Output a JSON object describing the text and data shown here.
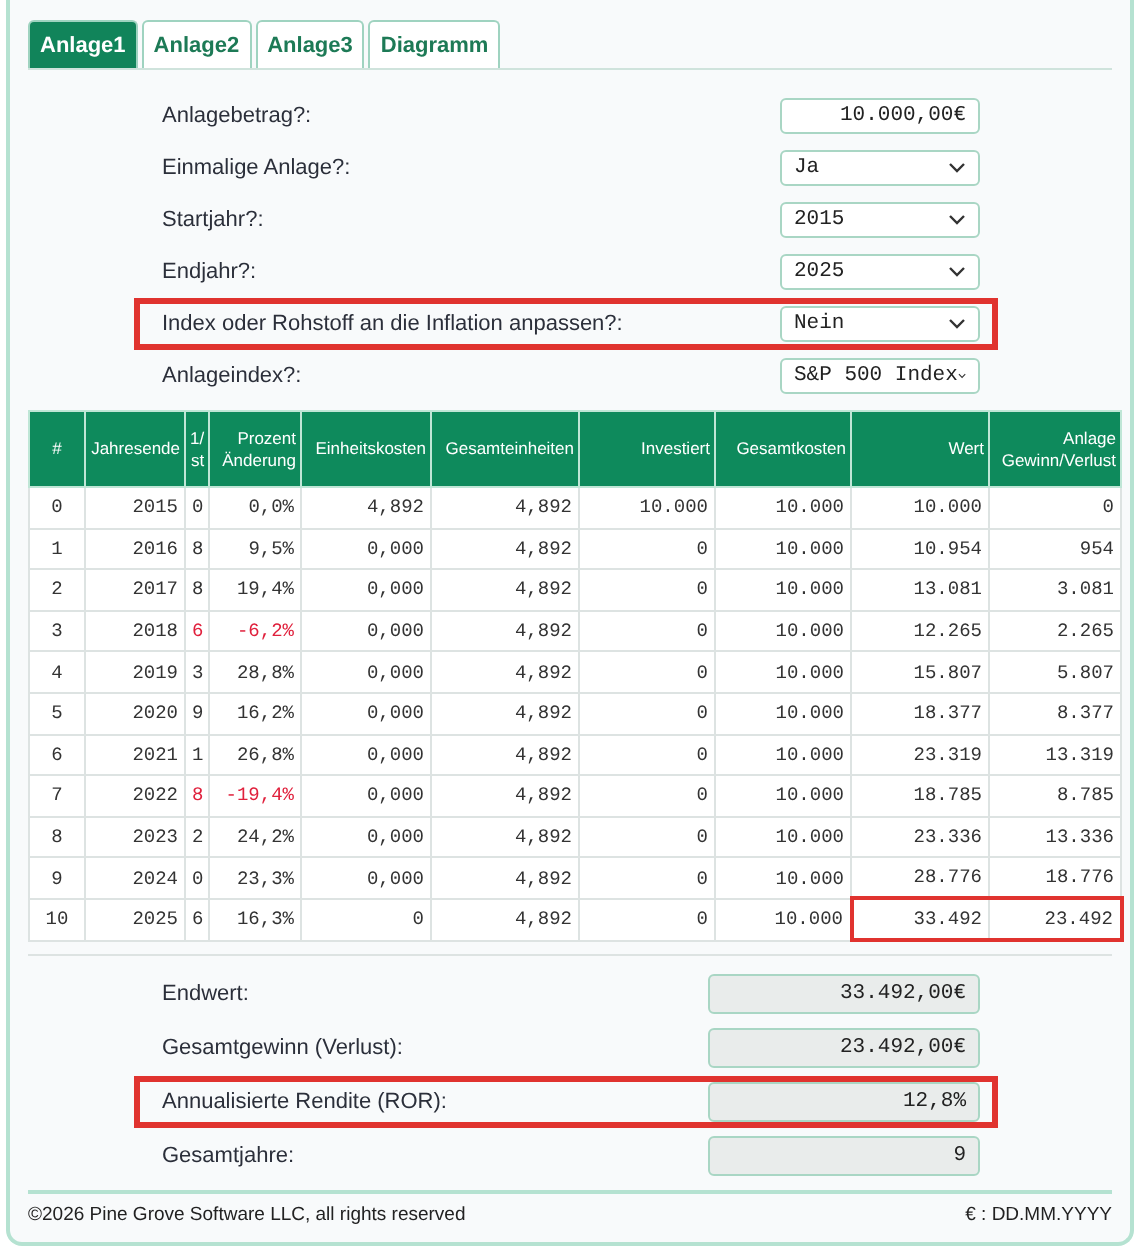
{
  "tabs": [
    {
      "label": "Anlage1",
      "selected": true
    },
    {
      "label": "Anlage2",
      "selected": false
    },
    {
      "label": "Anlage3",
      "selected": false
    },
    {
      "label": "Diagramm",
      "selected": false
    }
  ],
  "form": [
    {
      "label": "Anlagebetrag?:",
      "kind": "input",
      "value": "10.000,00€",
      "marked": false
    },
    {
      "label": "Einmalige Anlage?:",
      "kind": "select",
      "value": "Ja",
      "marked": false
    },
    {
      "label": "Startjahr?:",
      "kind": "select",
      "value": "2015",
      "marked": false
    },
    {
      "label": "Endjahr?:",
      "kind": "select",
      "value": "2025",
      "marked": false
    },
    {
      "label": "Index oder Rohstoff an die Inflation anpassen?:",
      "kind": "select",
      "value": "Nein",
      "marked": true
    },
    {
      "label": "Anlageindex?:",
      "kind": "select",
      "value": "S&P 500 Index",
      "marked": false
    }
  ],
  "table": {
    "columns": [
      "#",
      "Jahresende",
      "1/ st",
      "Prozent Änderung",
      "Einheitskosten",
      "Gesamteinheiten",
      "Investiert",
      "Gesamtkosten",
      "Wert",
      "Anlage Gewinn/Verlust"
    ],
    "rows": [
      {
        "cells": [
          "0",
          "2015",
          "0",
          "0,0%",
          "4,892",
          "4,892",
          "10.000",
          "10.000",
          "10.000",
          "0"
        ],
        "negative": false,
        "marked": false
      },
      {
        "cells": [
          "1",
          "2016",
          "8",
          "9,5%",
          "0,000",
          "4,892",
          "0",
          "10.000",
          "10.954",
          "954"
        ],
        "negative": false,
        "marked": false
      },
      {
        "cells": [
          "2",
          "2017",
          "8",
          "19,4%",
          "0,000",
          "4,892",
          "0",
          "10.000",
          "13.081",
          "3.081"
        ],
        "negative": false,
        "marked": false
      },
      {
        "cells": [
          "3",
          "2018",
          "6",
          "-6,2%",
          "0,000",
          "4,892",
          "0",
          "10.000",
          "12.265",
          "2.265"
        ],
        "negative": true,
        "marked": false
      },
      {
        "cells": [
          "4",
          "2019",
          "3",
          "28,8%",
          "0,000",
          "4,892",
          "0",
          "10.000",
          "15.807",
          "5.807"
        ],
        "negative": false,
        "marked": false
      },
      {
        "cells": [
          "5",
          "2020",
          "9",
          "16,2%",
          "0,000",
          "4,892",
          "0",
          "10.000",
          "18.377",
          "8.377"
        ],
        "negative": false,
        "marked": false
      },
      {
        "cells": [
          "6",
          "2021",
          "1",
          "26,8%",
          "0,000",
          "4,892",
          "0",
          "10.000",
          "23.319",
          "13.319"
        ],
        "negative": false,
        "marked": false
      },
      {
        "cells": [
          "7",
          "2022",
          "8",
          "-19,4%",
          "0,000",
          "4,892",
          "0",
          "10.000",
          "18.785",
          "8.785"
        ],
        "negative": true,
        "marked": false
      },
      {
        "cells": [
          "8",
          "2023",
          "2",
          "24,2%",
          "0,000",
          "4,892",
          "0",
          "10.000",
          "23.336",
          "13.336"
        ],
        "negative": false,
        "marked": false
      },
      {
        "cells": [
          "9",
          "2024",
          "0",
          "23,3%",
          "0,000",
          "4,892",
          "0",
          "10.000",
          "28.776",
          "18.776"
        ],
        "negative": false,
        "marked": false
      },
      {
        "cells": [
          "10",
          "2025",
          "6",
          "16,3%",
          "0",
          "4,892",
          "0",
          "10.000",
          "33.492",
          "23.492"
        ],
        "negative": false,
        "marked": true
      }
    ]
  },
  "results": [
    {
      "label": "Endwert:",
      "value": "33.492,00€",
      "marked": false
    },
    {
      "label": "Gesamtgewinn (Verlust):",
      "value": "23.492,00€",
      "marked": false
    },
    {
      "label": "Annualisierte Rendite (ROR):",
      "value": "12,8%",
      "marked": true
    },
    {
      "label": "Gesamtjahre:",
      "value": "9",
      "marked": false
    }
  ],
  "footer": {
    "copyright": "©2026 Pine Grove Software LLC, all rights reserved",
    "format": "€ : DD.MM.YYYY"
  }
}
